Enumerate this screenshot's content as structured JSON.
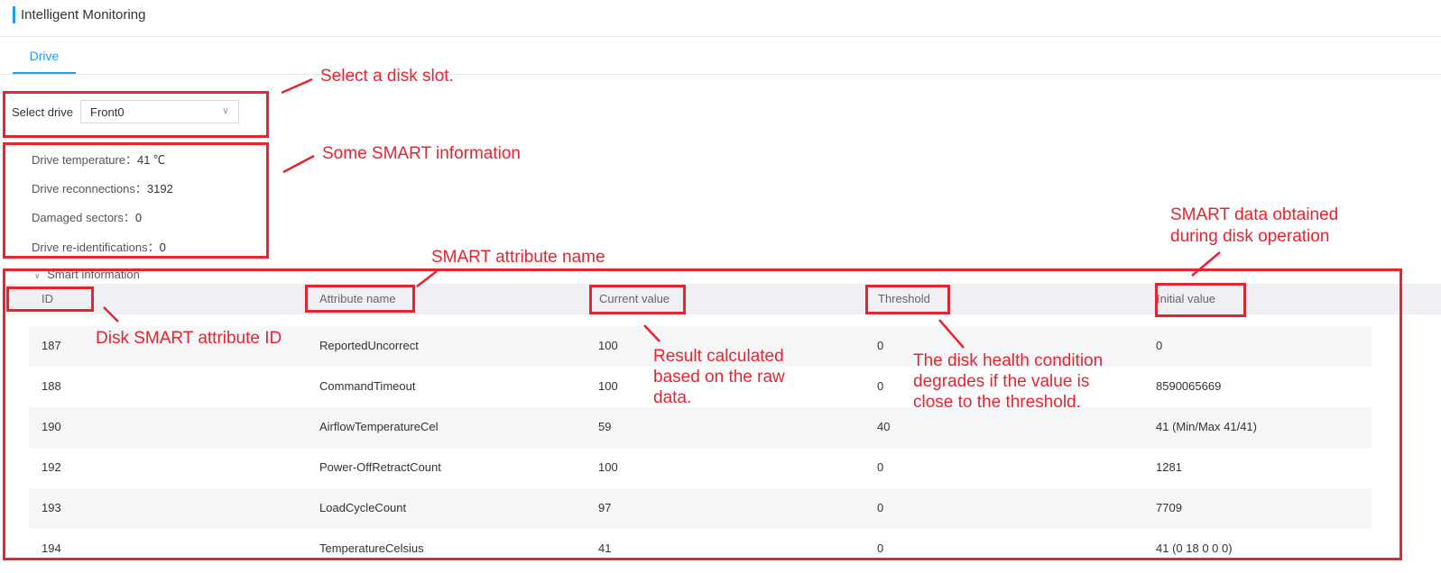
{
  "header": {
    "title": "Intelligent Monitoring"
  },
  "tabs": [
    {
      "label": "Drive",
      "active": true
    }
  ],
  "drive_select": {
    "label": "Select drive",
    "value": "Front0"
  },
  "drive_info": [
    {
      "label": "Drive temperature：",
      "value": "41 ℃"
    },
    {
      "label": "Drive reconnections：",
      "value": "3192"
    },
    {
      "label": "Damaged sectors：",
      "value": "0"
    },
    {
      "label": "Drive re-identifications：",
      "value": "0"
    }
  ],
  "smart_section": {
    "title": "Smart information"
  },
  "table": {
    "columns": [
      "ID",
      "Attribute name",
      "Current value",
      "Threshold",
      "Initial value"
    ],
    "rows": [
      [
        "187",
        "ReportedUncorrect",
        "100",
        "0",
        "0"
      ],
      [
        "188",
        "CommandTimeout",
        "100",
        "0",
        "8590065669"
      ],
      [
        "190",
        "AirflowTemperatureCel",
        "59",
        "40",
        "41 (Min/Max 41/41)"
      ],
      [
        "192",
        "Power-OffRetractCount",
        "100",
        "0",
        "1281"
      ],
      [
        "193",
        "LoadCycleCount",
        "97",
        "0",
        "7709"
      ],
      [
        "194",
        "TemperatureCelsius",
        "41",
        "0",
        "41 (0 18 0 0 0)"
      ]
    ]
  },
  "annotations": {
    "select_slot": "Select a disk slot.",
    "smart_info": "Some SMART information",
    "attr_name": "SMART attribute name",
    "smart_obtained_1": "SMART data obtained",
    "smart_obtained_2": "during disk operation",
    "attr_id": "Disk SMART attribute ID",
    "result_1": "Result calculated",
    "result_2": "based on the raw",
    "result_3": "data.",
    "health_1": "The disk health condition",
    "health_2": "degrades if the value is",
    "health_3": "close to the threshold."
  },
  "colors": {
    "accent": "#1ba0f0",
    "annotation": "#e8232f",
    "header_bg": "#eef0f3",
    "row_alt": "#f5f6f8"
  }
}
